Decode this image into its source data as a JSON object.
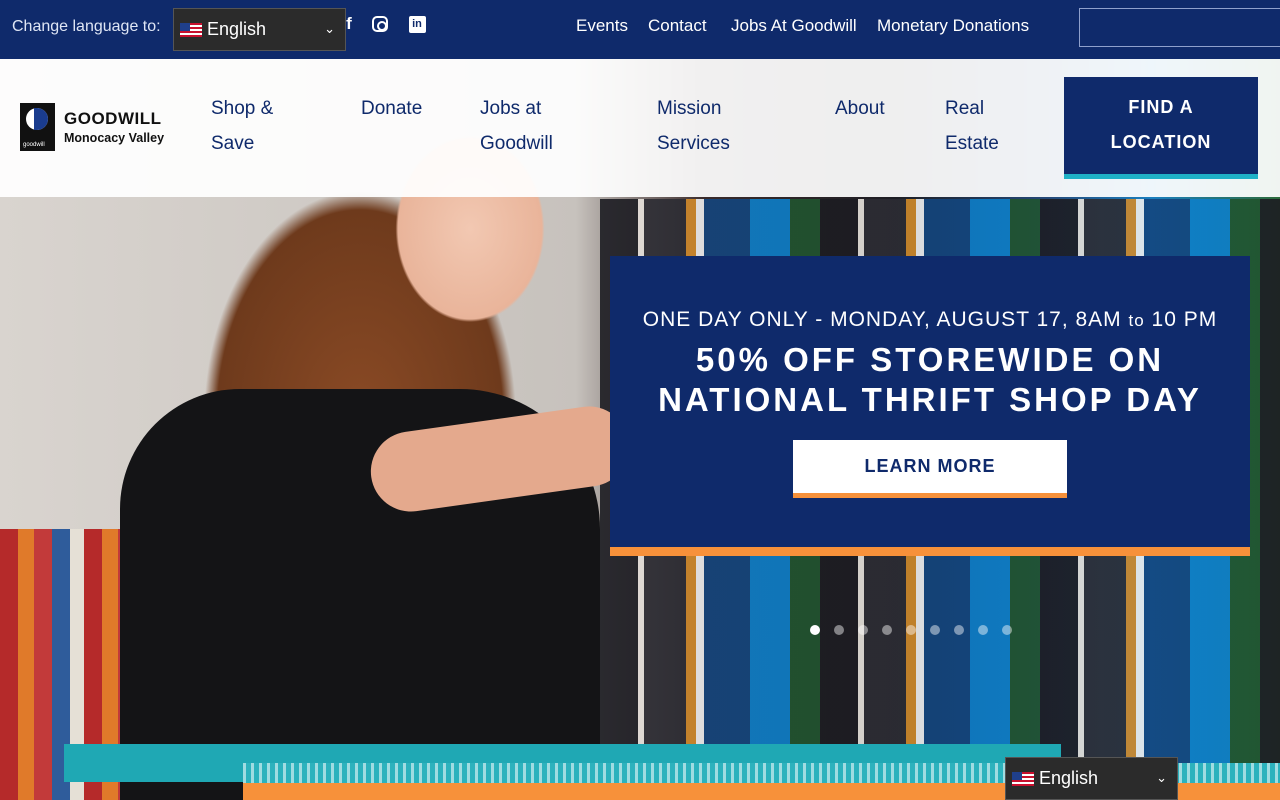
{
  "topbar": {
    "language_label": "Change language to:",
    "language_selected": "English",
    "social": [
      "facebook-icon",
      "instagram-icon",
      "linkedin-icon"
    ],
    "links": [
      "Events",
      "Contact",
      "Jobs At Goodwill",
      "Monetary Donations"
    ],
    "search_placeholder": ""
  },
  "logo": {
    "name": "GOODWILL",
    "subtitle": "Monocacy Valley",
    "mark_text": "goodwill"
  },
  "mainnav": {
    "items": [
      {
        "label_line1": "Shop &",
        "label_line2": "Save"
      },
      {
        "label_line1": "Donate",
        "label_line2": ""
      },
      {
        "label_line1": "Jobs at",
        "label_line2": "Goodwill"
      },
      {
        "label_line1": "Mission",
        "label_line2": "Services"
      },
      {
        "label_line1": "About",
        "label_line2": ""
      },
      {
        "label_line1": "Real",
        "label_line2": "Estate"
      }
    ],
    "cta_line1": "FIND A",
    "cta_line2": "LOCATION"
  },
  "promo": {
    "kicker_pre": "ONE DAY ONLY - MONDAY, AUGUST 17, 8AM ",
    "kicker_to": "to",
    "kicker_post": " 10 PM",
    "title_line1": "50% OFF STOREWIDE ON",
    "title_line2": "NATIONAL THRIFT SHOP DAY",
    "button": "LEARN MORE"
  },
  "carousel": {
    "slide_count": 9,
    "active_index": 0
  },
  "footer_language": {
    "selected": "English"
  },
  "colors": {
    "navy": "#0f2a6b",
    "teal": "#1fa8b4",
    "orange": "#f7913a",
    "white": "#ffffff"
  }
}
